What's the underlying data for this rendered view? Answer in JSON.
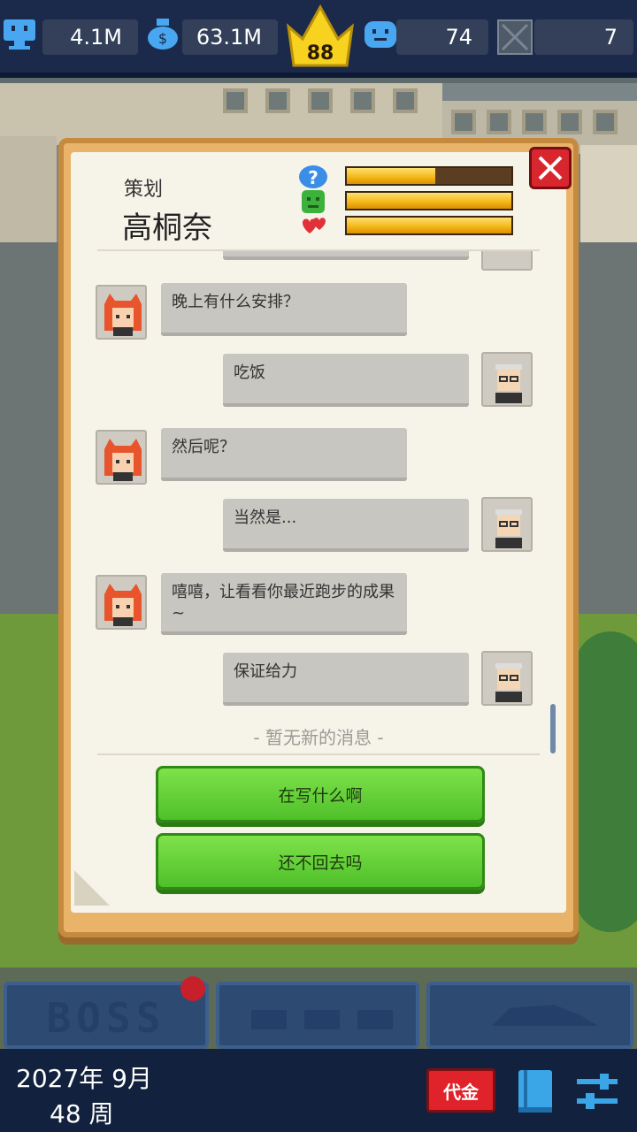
{
  "top_bar": {
    "employees_value": "4.1M",
    "money_value": "63.1M",
    "level": "88",
    "fans_value": "74",
    "locked_value": "7"
  },
  "dialog": {
    "job_title": "策划",
    "person_name": "高桐奈",
    "stats": [
      {
        "icon": "question-icon",
        "fill_percent": 54,
        "color": "#3a8ee6"
      },
      {
        "icon": "green-face-icon",
        "fill_percent": 100,
        "color": "#3cb23c"
      },
      {
        "icon": "hearts-icon",
        "fill_percent": 100,
        "color": "#e0303a"
      }
    ],
    "messages": [
      {
        "from": "her",
        "text": "晚上有什么安排？"
      },
      {
        "from": "me",
        "text": "吃饭"
      },
      {
        "from": "her",
        "text": "然后呢？"
      },
      {
        "from": "me",
        "text": "当然是..."
      },
      {
        "from": "her",
        "text": "嘻嘻，让看看你最近跑步的成果~"
      },
      {
        "from": "me",
        "text": "保证给力"
      }
    ],
    "no_new_messages": "- 暂无新的消息 -",
    "choices": [
      "在写什么啊",
      "还不回去吗"
    ]
  },
  "bottom_tabs": {
    "boss_label": "BOSS"
  },
  "bottom_bar": {
    "date": "2027年 9月",
    "week": "48 周",
    "daijin_label": "代金"
  },
  "colors": {
    "accent_green": "#4fc02a",
    "close_red": "#d8262e",
    "dialog_border": "#e9b46a",
    "top_bar_bg": "#1b2a4a"
  }
}
